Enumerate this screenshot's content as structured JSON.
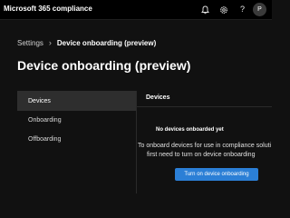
{
  "app": {
    "title": "Microsoft 365 compliance",
    "avatar_initial": "P",
    "icons": [
      "bell-icon",
      "gear-icon",
      "help-icon"
    ]
  },
  "breadcrumb": {
    "parent": "Settings",
    "separator": "›",
    "current": "Device onboarding (preview)"
  },
  "page": {
    "title": "Device onboarding (preview)"
  },
  "nav": {
    "items": [
      {
        "label": "Devices",
        "active": true
      },
      {
        "label": "Onboarding",
        "active": false
      },
      {
        "label": "Offboarding",
        "active": false
      }
    ]
  },
  "content": {
    "title": "Devices",
    "empty_title": "No devices onboarded yet",
    "empty_desc_line1": "To onboard devices for use in compliance soluti",
    "empty_desc_line2": "first need to turn on device onboarding",
    "button_label": "Turn on device onboarding"
  },
  "colors": {
    "accent": "#2b7fd6",
    "background": "#111111",
    "topbar": "#000000",
    "active_nav": "#2e2e2e"
  }
}
